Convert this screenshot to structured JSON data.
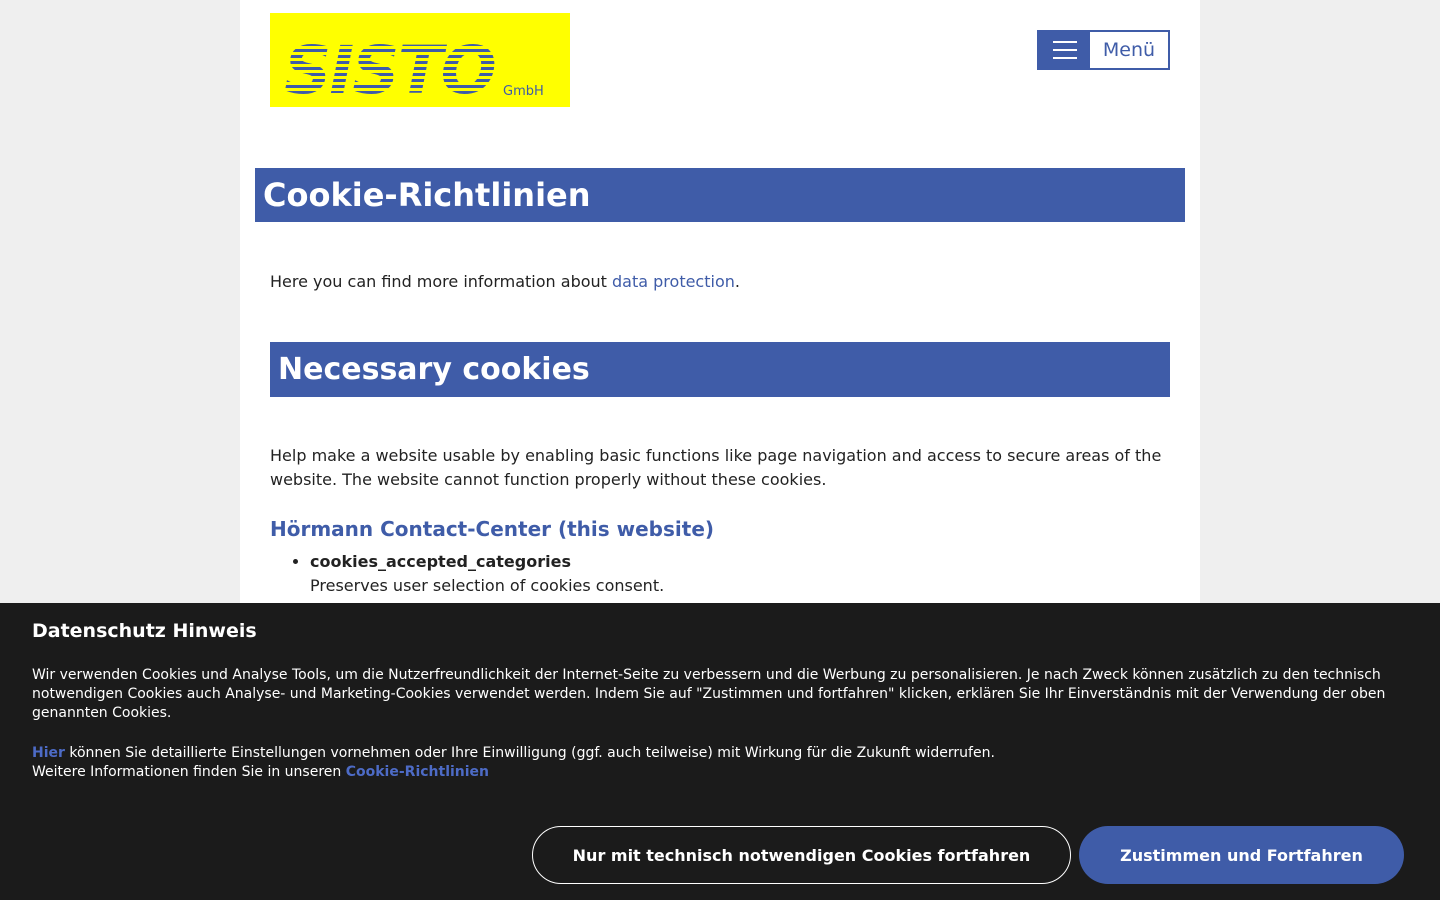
{
  "header": {
    "logo_text": "SISTO",
    "logo_suffix": "GmbH",
    "menu_label": "Menü"
  },
  "page": {
    "title": "Cookie-Richtlinien",
    "intro_prefix": "Here you can find more information about ",
    "intro_link": "data protection",
    "intro_suffix": ".",
    "section_title": "Necessary cookies",
    "section_desc": "Help make a website usable by enabling basic functions like page navigation and access to secure areas of the website. The website cannot function properly without these cookies.",
    "provider_title": "Hörmann Contact-Center (this website)",
    "cookies": [
      {
        "name": "cookies_accepted_categories",
        "desc": "Preserves user selection of cookies consent."
      }
    ]
  },
  "banner": {
    "title": "Datenschutz Hinweis",
    "text": "Wir verwenden Cookies und Analyse Tools, um die Nutzerfreundlichkeit der Internet-Seite zu verbessern und die Werbung zu personalisieren. Je nach Zweck können zusätzlich zu den technisch notwendigen Cookies auch Analyse- und Marketing-Cookies verwendet werden. Indem Sie auf \"Zustimmen und fortfahren\" klicken, erklären Sie Ihr Einverständnis mit der Verwendung der oben genannten Cookies.",
    "settings_link": "Hier",
    "settings_text": " können Sie detaillierte Einstellungen vornehmen oder Ihre Einwilligung (ggf. auch teilweise) mit Wirkung für die Zukunft widerrufen.",
    "more_info_text": "Weitere Informationen finden Sie in unseren ",
    "policy_link": "Cookie-Richtlinien",
    "btn_necessary": "Nur mit technisch notwendigen Cookies fortfahren",
    "btn_accept": "Zustimmen und Fortfahren"
  },
  "colors": {
    "brand_blue": "#3f5ca8",
    "logo_yellow": "#ffff00",
    "banner_bg": "#141414"
  }
}
